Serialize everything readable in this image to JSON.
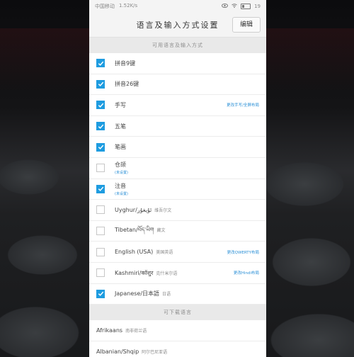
{
  "status_bar": {
    "carrier": "中国移动",
    "speed": "1.52K/s",
    "battery_text": "19"
  },
  "header": {
    "title": "语言及输入方式设置",
    "edit_label": "编辑"
  },
  "sections": {
    "available": "可用语言及输入方式",
    "downloadable": "可下载语言"
  },
  "input_methods": [
    {
      "label": "拼音9键",
      "checked": true
    },
    {
      "label": "拼音26键",
      "checked": true
    },
    {
      "label": "手写",
      "checked": true,
      "link": "更改手写/全屏布局"
    },
    {
      "label": "五笔",
      "checked": true
    },
    {
      "label": "笔画",
      "checked": true
    },
    {
      "label": "仓颉",
      "checked": false,
      "note": "(未设置)"
    },
    {
      "label": "注音",
      "checked": true,
      "note": "(未设置)"
    },
    {
      "label": "Uyghur/ئۇيغۇر",
      "sub": "维吾尔文",
      "checked": false
    },
    {
      "label": "Tibetan/བོད་ཡིག",
      "sub": "藏文",
      "checked": false
    },
    {
      "label": "English (USA)",
      "sub": "美国英语",
      "checked": false,
      "link": "更改QWERTY布局"
    },
    {
      "label": "Kashmiri/कॉशुर",
      "sub": "克什米尔语",
      "checked": false,
      "link": "更改Hindi布局"
    },
    {
      "label": "Japanese/日本語",
      "sub": "日语",
      "checked": true
    }
  ],
  "downloadable_languages": [
    {
      "label": "Afrikaans",
      "sub": "南非荷兰语"
    },
    {
      "label": "Albanian/Shqip",
      "sub": "阿尔巴尼亚语"
    }
  ]
}
